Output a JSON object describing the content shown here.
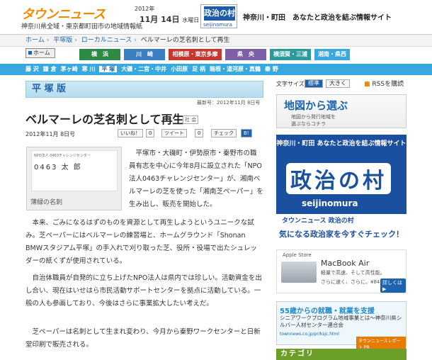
{
  "header": {
    "logo": "タウンニュース",
    "tagline": "神奈川県全域・東京都町田市の地域情報紙",
    "year": "2012年",
    "date": "11月 14日",
    "weekday": "水曜日",
    "banner_title": "政治の村",
    "banner_sub": "seijinomura",
    "banner_text": "神奈川・町田　あなたと政治を結ぶ情報サイト"
  },
  "breadcrumb": [
    "ホーム",
    "平塚版",
    "ローカルニュース",
    "ベルマーレの芝名刺として再生"
  ],
  "home_label": "ホーム",
  "regions": [
    {
      "label": "横　浜",
      "color": "#2c8a45"
    },
    {
      "label": "川　崎",
      "color": "#3a7fc4"
    },
    {
      "label": "相模原・東京多摩",
      "color": "#c7362c"
    },
    {
      "label": "県　央",
      "color": "#7d5fa8"
    },
    {
      "label": "横須賀・三浦",
      "color": "#2a9a9a"
    },
    {
      "label": "湘南・県西",
      "color": "#38a9df"
    }
  ],
  "cities": [
    "藤 沢",
    "鎌 倉",
    "茅ヶ崎",
    "寒 川",
    "平 塚",
    "大磯・二宮・中井",
    "小田原",
    "足 柄",
    "箱根・湯河原・真鶴",
    "秦 野"
  ],
  "active_city": "平 塚",
  "article": {
    "edition": "平 塚 版",
    "updated": "最新号：2012年11月 8日号",
    "title": "ベルマーレの芝名刺として再生",
    "tag": "社 会",
    "date": "2012年11月 8日号",
    "share": [
      "いいね！",
      "0",
      "ツイート",
      "0",
      "チェック"
    ],
    "card_org": "NPO法人 0463チャレンジセンター",
    "card_name": "0463 太 郎",
    "caption": "薄緑の名刺",
    "p1": "平塚市・大磯町・伊勢原市・秦野市の職員有志を中心に今年8月に設立された「NPO法人0463チャレンジセンター」が、湘南ベルマーレの芝を使った「湘南芝ペーパー」を生み出し、販売を開始した。",
    "p2": "本来、ごみになるはずのものを資源として再生しようというユニークな試み。芝ペーパーにはベルマーレの練習場と、ホームグラウンド「Shonan BMWスタジアム平塚」の手入れで刈り取った芝、役所・役場で出たシュレッダーの紙くずが使用されている。",
    "p3": "自治体職員が自発的に立ち上げたNPO法人は県内では珍しい。活動資金を出し合い、現在はいせはら市民活動サポートセンターを拠点に活動している。一般の人も参画しており、今後はさらに事業拡大したい考えだ。",
    "p4": "芝ペーパーは名刺として生まれ変わり、今月から秦野ワークセンターと日新堂印刷で販売される。"
  },
  "sidebar": {
    "fontsize_label": "文字サイズ",
    "font_standard": "標準",
    "font_large": "大きく",
    "rss": "RSSを購読",
    "map_title": "地図から選ぶ",
    "map_sub1": "地図から発行地域を",
    "map_sub2": "選ぶならコチラ",
    "ad_header": "神奈川・町田 あなたと政治を結ぶ情報サイト",
    "ad_big": "政治の村",
    "ad_roman": "seijinomura",
    "ad_strip1": "タウンニュース 政治の村",
    "ad_strip2": "気になる政治家を今すぐチェック！",
    "apple_store": "Apple Store",
    "apple_product": "MacBook Air",
    "apple_desc": "軽量で高速、そして高性能。",
    "apple_price": "さらに速く、さらに。¥84,800～",
    "apple_cta": "詳しくは ▶",
    "job_title": "55歳からの就職・就業を支援",
    "job_desc": "シニアワークプログラム地域事業とは～神奈川県シルバー人材センター連合会",
    "job_url": "townnews.co.jp/pr/ksjc.html",
    "job_report": "タウンニュースレポート PR",
    "category": "カテゴリ"
  }
}
